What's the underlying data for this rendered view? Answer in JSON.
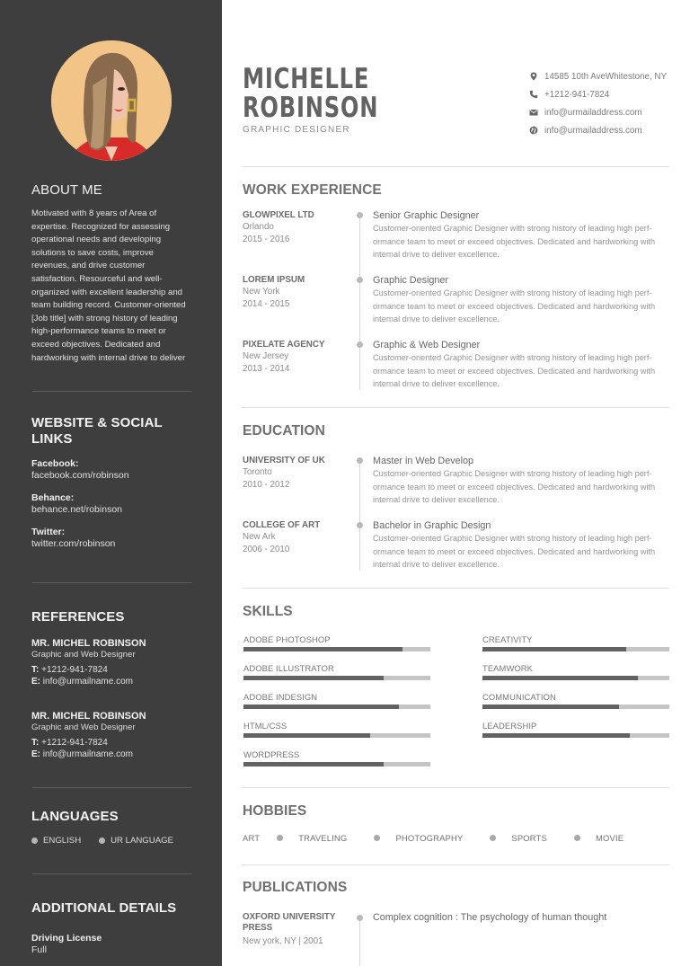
{
  "profile": {
    "first_name": "MICHELLE",
    "last_name": "ROBINSON",
    "title": "GRAPHIC DESIGNER",
    "photo_alt": "profile-photo"
  },
  "contact": [
    {
      "icon": "map-pin-icon",
      "text": "14585 10th AveWhitestone, NY"
    },
    {
      "icon": "phone-icon",
      "text": "+1212-941-7824"
    },
    {
      "icon": "envelope-icon",
      "text": "info@urmailaddress.com"
    },
    {
      "icon": "globe-icon",
      "text": "info@urmailaddress.com"
    }
  ],
  "sidebar": {
    "about": {
      "heading": "ABOUT ME",
      "text": "Motivated  with 8 years of Area of expertise. Recognized for assessing operational needs and developing solutions to save costs, improve revenues, and drive customer satisfaction. Resourceful and well-organized with excellent leadership and team building record. Customer-oriented [Job title] with strong history of leading high-performance teams to meet or exceed objectives. Dedicated and hardworking with internal drive to deliver"
    },
    "links": {
      "heading_line1": "WEBSITE & SOCIAL",
      "heading_line2": "LINKS",
      "items": [
        {
          "label": "Facebook:",
          "value": "facebook.com/robinson"
        },
        {
          "label": "Behance:",
          "value": "behance.net/robinson"
        },
        {
          "label": "Twitter:",
          "value": "twitter.com/robinson"
        }
      ]
    },
    "references": {
      "heading": "REFERENCES",
      "items": [
        {
          "name": "MR. MICHEL ROBINSON",
          "role": "Graphic and Web Designer",
          "phone_label": "T:",
          "phone": "+1212-941-7824",
          "email_label": "E:",
          "email": "info@urmailname.com"
        },
        {
          "name": "MR. MICHEL ROBINSON",
          "role": "Graphic and Web Designer",
          "phone_label": "T:",
          "phone": "+1212-941-7824",
          "email_label": "E:",
          "email": "info@urmailname.com"
        }
      ]
    },
    "languages": {
      "heading": "LANGUAGES",
      "items": [
        "ENGLISH",
        "UR LANGUAGE"
      ]
    },
    "additional": {
      "heading": "ADDITIONAL DETAILS",
      "label": "Driving License",
      "value": "Full"
    }
  },
  "work": {
    "heading": "WORK EXPERIENCE",
    "items": [
      {
        "org": "GLOWPIXEL LTD",
        "location": "Orlando",
        "years": "2015 - 2016",
        "position": "Senior Graphic Designer",
        "description": "Customer-oriented Graphic Designer with strong history of leading high perf-ormance team to meet or exceed objectives. Dedicated and hardworking with internal drive to deliver excellence."
      },
      {
        "org": "LOREM IPSUM",
        "location": "New York",
        "years": "2014 - 2015",
        "position": "Graphic Designer",
        "description": "Customer-oriented Graphic Designer with strong history of leading high perf-ormance team to meet or exceed objectives. Dedicated and hardworking with internal drive to deliver excellence."
      },
      {
        "org": "PIXELATE AGENCY",
        "location": "New Jersey",
        "years": "2013 - 2014",
        "position": "Graphic & Web Designer",
        "description": "Customer-oriented Graphic Designer with strong history of leading high perf-ormance team to meet or exceed objectives. Dedicated and hardworking with internal drive to deliver excellence."
      }
    ]
  },
  "education": {
    "heading": "EDUCATION",
    "items": [
      {
        "org": "UNIVERSITY OF UK",
        "location": "Toronto",
        "years": "2010 - 2012",
        "position": "Master in Web Develop",
        "description": "Customer-oriented Graphic Designer with strong history of leading high perf-ormance team to meet or exceed objectives. Dedicated and hardworking with internal drive to deliver excellence."
      },
      {
        "org": "COLLEGE OF ART",
        "location": "New Ark",
        "years": "2006 - 2010",
        "position": "Bachelor in Graphic Design",
        "description": "Customer-oriented Graphic Designer with strong history of leading high perf-ormance team to meet or exceed objectives. Dedicated and hardworking with internal drive to deliver excellence."
      }
    ]
  },
  "skills": {
    "heading": "SKILLS",
    "left": [
      {
        "name": "ADOBE PHOTOSHOP",
        "level": 0.85
      },
      {
        "name": "ADOBE ILLUSTRATOR",
        "level": 0.75
      },
      {
        "name": "ADOBE INDESIGN",
        "level": 0.83
      },
      {
        "name": "HTML/CSS",
        "level": 0.68
      },
      {
        "name": "WORDPRESS",
        "level": 0.75
      }
    ],
    "right": [
      {
        "name": "CREATIVITY",
        "level": 0.77
      },
      {
        "name": "TEAMWORK",
        "level": 0.83
      },
      {
        "name": "COMMUNICATION",
        "level": 0.73
      },
      {
        "name": "LEADERSHIP",
        "level": 0.79
      }
    ]
  },
  "hobbies": {
    "heading": "HOBBIES",
    "items": [
      "ART",
      "TRAVELING",
      "PHOTOGRAPHY",
      "SPORTS",
      "MOVIE"
    ]
  },
  "publications": {
    "heading": "PUBLICATIONS",
    "items": [
      {
        "org_line1": "OXFORD UNIVERSITY",
        "org_line2": "PRESS",
        "meta": "New york, NY  |  2001",
        "title": "Complex cognition : The psychology of human thought"
      }
    ]
  },
  "colors": {
    "sidebar_bg": "#3e3e3e",
    "bar_fill": "#626262",
    "bar_track": "#c5c5c5",
    "heading_text": "#707070"
  }
}
